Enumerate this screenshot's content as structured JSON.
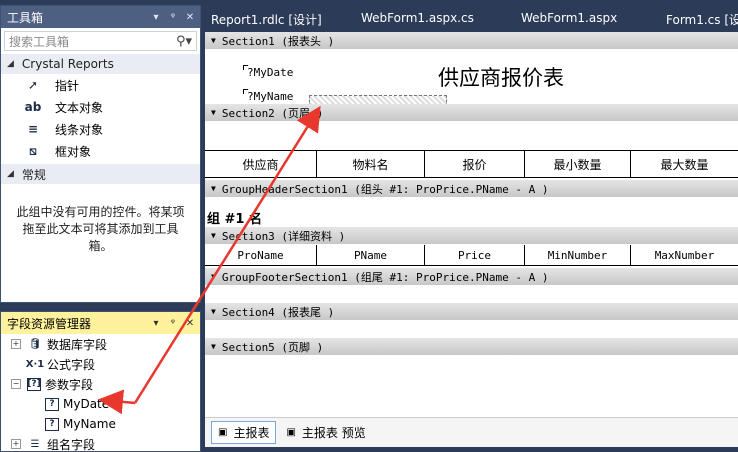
{
  "toolbox": {
    "title": "工具箱",
    "pin_glyphs": [
      "▾",
      "ᵠ",
      "✕"
    ],
    "search_placeholder": "搜索工具箱",
    "group1": "Crystal Reports",
    "items": [
      {
        "label": "指针",
        "icon": "pointer-icon"
      },
      {
        "label": "文本对象",
        "icon": "text-object-icon"
      },
      {
        "label": "线条对象",
        "icon": "line-object-icon"
      },
      {
        "label": "框对象",
        "icon": "box-object-icon"
      }
    ],
    "group2": "常规",
    "empty_message": "此组中没有可用的控件。将某项拖至此文本可将其添加到工具箱。"
  },
  "field_manager": {
    "title": "字段资源管理器",
    "items": [
      {
        "label": "数据库字段",
        "icon": "database-icon",
        "expand": "+"
      },
      {
        "label": "公式字段",
        "icon": "formula-icon",
        "expand": ""
      },
      {
        "label": "参数字段",
        "icon": "parameter-icon",
        "expand": "−"
      },
      {
        "label": "MyDate",
        "icon": "parameter-item-icon",
        "expand": ""
      },
      {
        "label": "MyName",
        "icon": "parameter-item-icon",
        "expand": ""
      },
      {
        "label": "组名字段",
        "icon": "group-name-icon",
        "expand": "+"
      }
    ]
  },
  "tabs": [
    "Report1.rdlc [设计]",
    "WebForm1.aspx.cs",
    "WebForm1.aspx",
    "Form1.cs [设"
  ],
  "report": {
    "sections": [
      "Section1 (报表头 )",
      "Section2 (页眉 )",
      "GroupHeaderSection1 (组头 #1: ProPrice.PName - A )",
      "Section3 (详细资料 )",
      "GroupFooterSection1 (组尾 #1: ProPrice.PName - A )",
      "Section4 (报表尾 )",
      "Section5 (页脚 )"
    ],
    "title": "供应商报价表",
    "param_mydate": "?MyDate",
    "param_myname": "?MyName",
    "headers": [
      "供应商",
      "物料名",
      "报价",
      "最小数量",
      "最大数量"
    ],
    "details": [
      "ProName",
      "PName",
      "Price",
      "MinNumber",
      "MaxNumber"
    ],
    "group_label": "组 #1 名"
  },
  "bottom_tabs": [
    "主报表",
    "主报表 预览"
  ],
  "colors": {
    "panel_title": "#4d6082",
    "active_panel_title": "#fff29d",
    "arrow": "#e8382d"
  }
}
